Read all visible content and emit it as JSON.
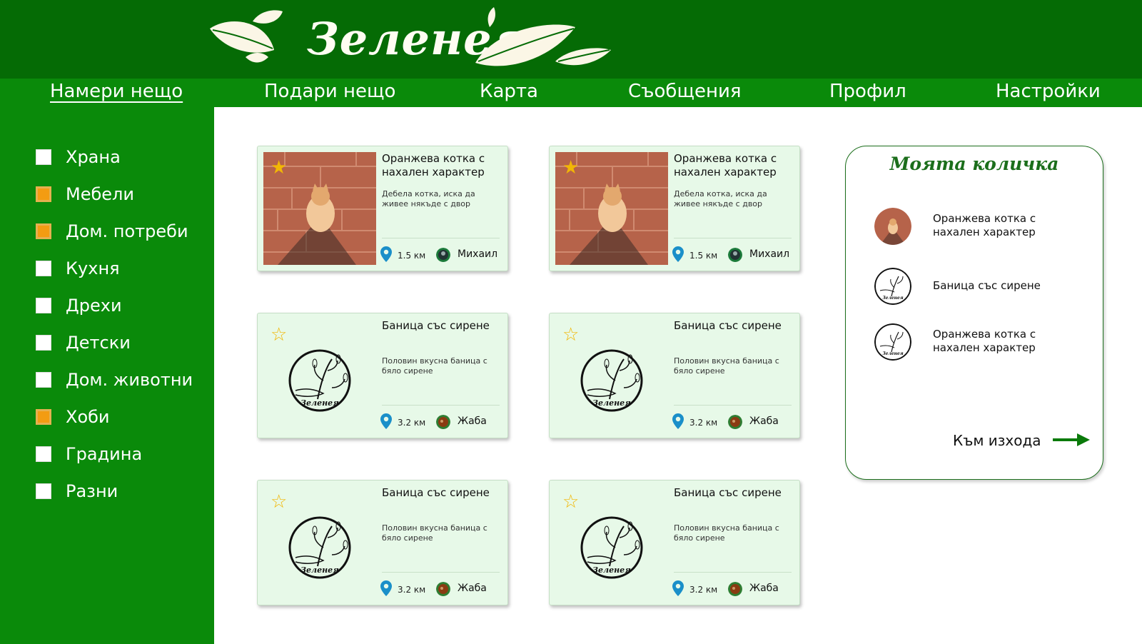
{
  "brand": {
    "name": "Зеленея"
  },
  "nav": [
    {
      "label": "Намери нещо",
      "active": true
    },
    {
      "label": "Подари нещо"
    },
    {
      "label": "Карта"
    },
    {
      "label": "Съобщения"
    },
    {
      "label": "Профил"
    },
    {
      "label": "Настройки"
    }
  ],
  "categories": [
    {
      "label": "Храна",
      "checked": false
    },
    {
      "label": "Мебели",
      "checked": true
    },
    {
      "label": "Дом. потреби",
      "checked": true
    },
    {
      "label": "Кухня",
      "checked": false
    },
    {
      "label": "Дрехи",
      "checked": false
    },
    {
      "label": "Детски",
      "checked": false
    },
    {
      "label": "Дом. животни",
      "checked": false
    },
    {
      "label": "Хоби",
      "checked": true
    },
    {
      "label": "Градина",
      "checked": false
    },
    {
      "label": "Разни",
      "checked": false
    }
  ],
  "listings": [
    {
      "title": "Оранжева котка с нахален характер",
      "desc": "Дебела котка, иска да живее някъде с двор",
      "distance": "1.5 км",
      "user": "Михаил",
      "favorite": true,
      "image": "cat-photo",
      "star_icon": "star-filled-icon"
    },
    {
      "title": "Оранжева котка с нахален характер",
      "desc": "Дебела котка, иска да живее някъде с двор",
      "distance": "1.5 км",
      "user": "Михаил",
      "favorite": true,
      "image": "cat-photo",
      "star_icon": "star-filled-icon"
    },
    {
      "title": "Баница със сирене",
      "desc": "Половин вкусна баница с бяло сирене",
      "distance": "3.2 км",
      "user": "Жаба",
      "favorite": false,
      "image": "zeleneya-logo",
      "star_icon": "star-outline-icon"
    },
    {
      "title": "Баница със сирене",
      "desc": "Половин вкусна баница с бяло сирене",
      "distance": "3.2 км",
      "user": "Жаба",
      "favorite": false,
      "image": "zeleneya-logo",
      "star_icon": "star-outline-icon"
    },
    {
      "title": "Баница със сирене",
      "desc": "Половин вкусна баница с бяло сирене",
      "distance": "3.2 км",
      "user": "Жаба",
      "favorite": false,
      "image": "zeleneya-logo",
      "star_icon": "star-outline-icon"
    },
    {
      "title": "Баница със сирене",
      "desc": "Половин вкусна баница с бяло сирене",
      "distance": "3.2 км",
      "user": "Жаба",
      "favorite": false,
      "image": "zeleneya-logo",
      "star_icon": "star-outline-icon"
    }
  ],
  "logo_text": "Зеленея",
  "cart": {
    "title": "Моята количка",
    "items": [
      {
        "name": "Оранжева котка с нахален характер",
        "thumb": "cat-photo"
      },
      {
        "name": "Баница със сирене",
        "thumb": "zeleneya-logo"
      },
      {
        "name": "Оранжева котка с нахален характер",
        "thumb": "zeleneya-logo"
      }
    ],
    "checkout_label": "Към изхода",
    "checkout_icon": "arrow-right-icon"
  },
  "colors": {
    "header": "#056b05",
    "nav": "#0a8a0a",
    "sidebar": "#0a8a0a",
    "card_bg": "#e7f9e8",
    "checkbox_checked": "#f39c12",
    "star": "#f2b705",
    "pin": "#1a8fc9",
    "cart_accent": "#1b6e1b"
  }
}
